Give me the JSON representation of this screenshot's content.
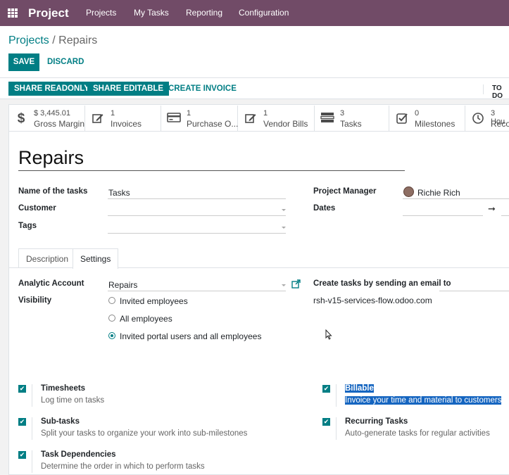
{
  "nav": {
    "brand": "Project",
    "menu": [
      "Projects",
      "My Tasks",
      "Reporting",
      "Configuration"
    ]
  },
  "breadcrumb": {
    "parent": "Projects",
    "separator": "/",
    "current": "Repairs"
  },
  "actions": {
    "save": "SAVE",
    "discard": "DISCARD"
  },
  "statusbar": {
    "share_readonly": "SHARE READONLY",
    "share_editable": "SHARE EDITABLE",
    "create_invoice": "CREATE INVOICE",
    "todo": "TO DO"
  },
  "smart_buttons": [
    {
      "icon": "dollar-icon",
      "value": "$ 3,445.01",
      "label": "Gross Margin"
    },
    {
      "icon": "edit-icon",
      "value": "1",
      "label": "Invoices"
    },
    {
      "icon": "credit-card-icon",
      "value": "1",
      "label": "Purchase O..."
    },
    {
      "icon": "edit-icon",
      "value": "1",
      "label": "Vendor Bills"
    },
    {
      "icon": "tasks-icon",
      "value": "3",
      "label": "Tasks"
    },
    {
      "icon": "check-square-icon",
      "value": "0",
      "label": "Milestones"
    },
    {
      "icon": "clock-icon",
      "value": "3 Hou",
      "label": "Reco"
    }
  ],
  "form": {
    "title": "Repairs",
    "tasks_label": "Name of the tasks",
    "tasks_value": "Tasks",
    "customer_label": "Customer",
    "tags_label": "Tags",
    "manager_label": "Project Manager",
    "manager_value": "Richie Rich",
    "dates_label": "Dates"
  },
  "tabs": [
    "Description",
    "Settings"
  ],
  "settings": {
    "analytic_label": "Analytic Account",
    "analytic_value": "Repairs",
    "email_label": "Create tasks by sending an email to",
    "email_value": "rsh-v15-services-flow.odoo.com",
    "visibility_label": "Visibility",
    "visibility_options": [
      "Invited employees",
      "All employees",
      "Invited portal users and all employees"
    ],
    "visibility_selected": 2
  },
  "features": [
    {
      "title": "Timesheets",
      "desc": "Log time on tasks",
      "checked": true
    },
    {
      "title": "Billable",
      "desc": "Invoice your time and material to customers",
      "checked": true
    },
    {
      "title": "Sub-tasks",
      "desc": "Split your tasks to organize your work into sub-milestones",
      "checked": true
    },
    {
      "title": "Recurring Tasks",
      "desc": "Auto-generate tasks for regular activities",
      "checked": true
    },
    {
      "title": "Task Dependencies",
      "desc": "Determine the order in which to perform tasks",
      "checked": true
    }
  ],
  "colors": {
    "brand": "#714B67",
    "accent": "#017e84",
    "highlight": "#1565c0"
  }
}
